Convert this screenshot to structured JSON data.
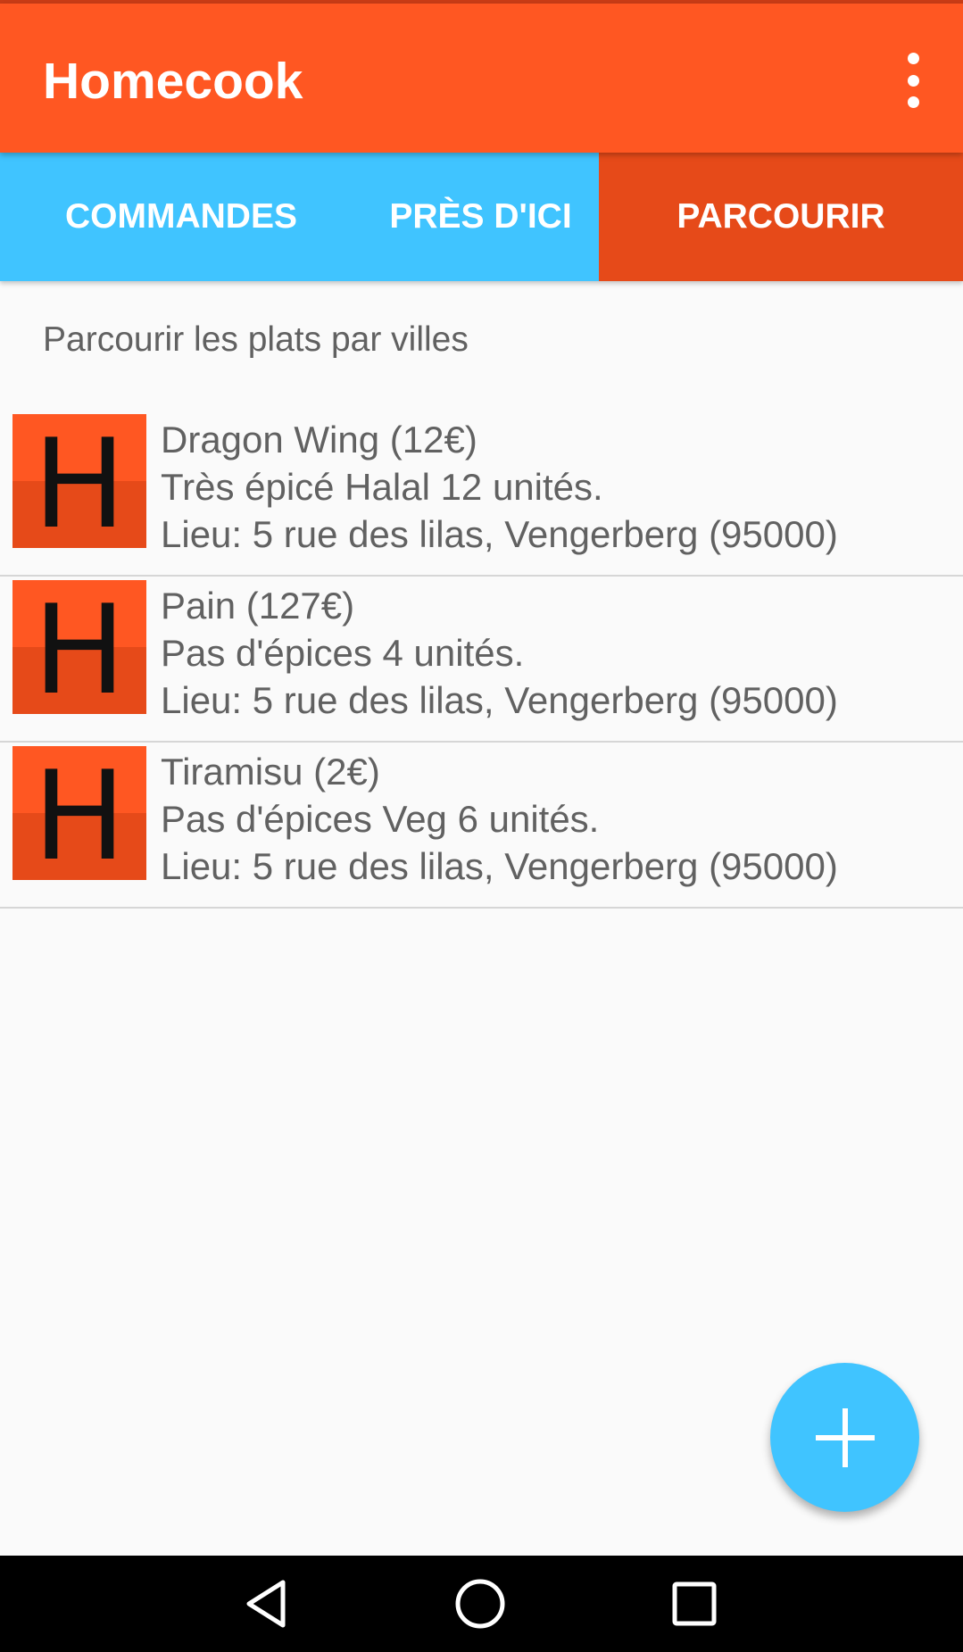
{
  "app": {
    "title": "Homecook",
    "accent_color": "#ff5722",
    "tab_color": "#40c4ff",
    "selected_tab_color": "#e64a19"
  },
  "tabs": [
    {
      "label": "COMMANDES",
      "selected": false
    },
    {
      "label": "PRÈS D'ICI",
      "selected": false
    },
    {
      "label": "PARCOURIR",
      "selected": true
    }
  ],
  "main": {
    "subtitle": "Parcourir les plats par villes",
    "items": [
      {
        "thumb_letter": "H",
        "title": "Dragon Wing (12€)",
        "details": "Très épicé Halal 12 unités.",
        "location": "Lieu: 5 rue des lilas, Vengerberg (95000)"
      },
      {
        "thumb_letter": "H",
        "title": "Pain (127€)",
        "details": "Pas d'épices 4 unités.",
        "location": "Lieu: 5 rue des lilas, Vengerberg (95000)"
      },
      {
        "thumb_letter": "H",
        "title": "Tiramisu (2€)",
        "details": "Pas d'épices Veg 6 unités.",
        "location": "Lieu: 5 rue des lilas, Vengerberg (95000)"
      }
    ]
  },
  "fab": {
    "icon": "plus-icon"
  },
  "navbar": {
    "icons": [
      "back-icon",
      "home-icon",
      "recents-icon"
    ]
  }
}
